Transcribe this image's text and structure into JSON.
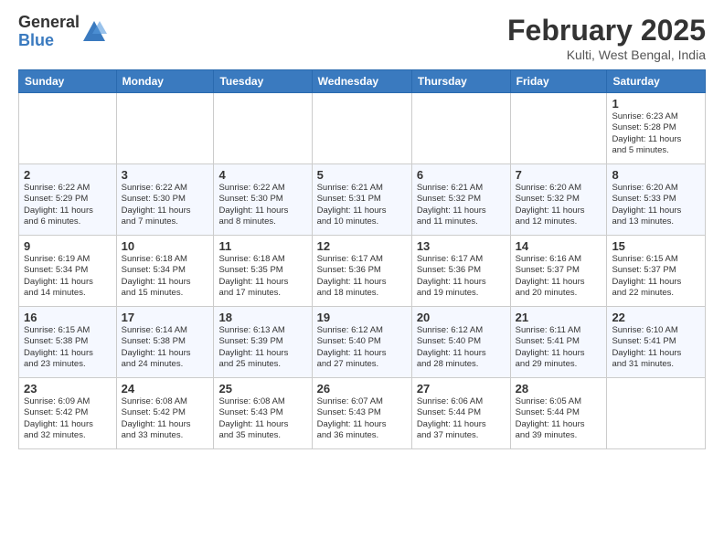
{
  "logo": {
    "general": "General",
    "blue": "Blue"
  },
  "title": "February 2025",
  "location": "Kulti, West Bengal, India",
  "days_of_week": [
    "Sunday",
    "Monday",
    "Tuesday",
    "Wednesday",
    "Thursday",
    "Friday",
    "Saturday"
  ],
  "weeks": [
    [
      {
        "day": "",
        "info": ""
      },
      {
        "day": "",
        "info": ""
      },
      {
        "day": "",
        "info": ""
      },
      {
        "day": "",
        "info": ""
      },
      {
        "day": "",
        "info": ""
      },
      {
        "day": "",
        "info": ""
      },
      {
        "day": "1",
        "info": "Sunrise: 6:23 AM\nSunset: 5:28 PM\nDaylight: 11 hours\nand 5 minutes."
      }
    ],
    [
      {
        "day": "2",
        "info": "Sunrise: 6:22 AM\nSunset: 5:29 PM\nDaylight: 11 hours\nand 6 minutes."
      },
      {
        "day": "3",
        "info": "Sunrise: 6:22 AM\nSunset: 5:30 PM\nDaylight: 11 hours\nand 7 minutes."
      },
      {
        "day": "4",
        "info": "Sunrise: 6:22 AM\nSunset: 5:30 PM\nDaylight: 11 hours\nand 8 minutes."
      },
      {
        "day": "5",
        "info": "Sunrise: 6:21 AM\nSunset: 5:31 PM\nDaylight: 11 hours\nand 10 minutes."
      },
      {
        "day": "6",
        "info": "Sunrise: 6:21 AM\nSunset: 5:32 PM\nDaylight: 11 hours\nand 11 minutes."
      },
      {
        "day": "7",
        "info": "Sunrise: 6:20 AM\nSunset: 5:32 PM\nDaylight: 11 hours\nand 12 minutes."
      },
      {
        "day": "8",
        "info": "Sunrise: 6:20 AM\nSunset: 5:33 PM\nDaylight: 11 hours\nand 13 minutes."
      }
    ],
    [
      {
        "day": "9",
        "info": "Sunrise: 6:19 AM\nSunset: 5:34 PM\nDaylight: 11 hours\nand 14 minutes."
      },
      {
        "day": "10",
        "info": "Sunrise: 6:18 AM\nSunset: 5:34 PM\nDaylight: 11 hours\nand 15 minutes."
      },
      {
        "day": "11",
        "info": "Sunrise: 6:18 AM\nSunset: 5:35 PM\nDaylight: 11 hours\nand 17 minutes."
      },
      {
        "day": "12",
        "info": "Sunrise: 6:17 AM\nSunset: 5:36 PM\nDaylight: 11 hours\nand 18 minutes."
      },
      {
        "day": "13",
        "info": "Sunrise: 6:17 AM\nSunset: 5:36 PM\nDaylight: 11 hours\nand 19 minutes."
      },
      {
        "day": "14",
        "info": "Sunrise: 6:16 AM\nSunset: 5:37 PM\nDaylight: 11 hours\nand 20 minutes."
      },
      {
        "day": "15",
        "info": "Sunrise: 6:15 AM\nSunset: 5:37 PM\nDaylight: 11 hours\nand 22 minutes."
      }
    ],
    [
      {
        "day": "16",
        "info": "Sunrise: 6:15 AM\nSunset: 5:38 PM\nDaylight: 11 hours\nand 23 minutes."
      },
      {
        "day": "17",
        "info": "Sunrise: 6:14 AM\nSunset: 5:38 PM\nDaylight: 11 hours\nand 24 minutes."
      },
      {
        "day": "18",
        "info": "Sunrise: 6:13 AM\nSunset: 5:39 PM\nDaylight: 11 hours\nand 25 minutes."
      },
      {
        "day": "19",
        "info": "Sunrise: 6:12 AM\nSunset: 5:40 PM\nDaylight: 11 hours\nand 27 minutes."
      },
      {
        "day": "20",
        "info": "Sunrise: 6:12 AM\nSunset: 5:40 PM\nDaylight: 11 hours\nand 28 minutes."
      },
      {
        "day": "21",
        "info": "Sunrise: 6:11 AM\nSunset: 5:41 PM\nDaylight: 11 hours\nand 29 minutes."
      },
      {
        "day": "22",
        "info": "Sunrise: 6:10 AM\nSunset: 5:41 PM\nDaylight: 11 hours\nand 31 minutes."
      }
    ],
    [
      {
        "day": "23",
        "info": "Sunrise: 6:09 AM\nSunset: 5:42 PM\nDaylight: 11 hours\nand 32 minutes."
      },
      {
        "day": "24",
        "info": "Sunrise: 6:08 AM\nSunset: 5:42 PM\nDaylight: 11 hours\nand 33 minutes."
      },
      {
        "day": "25",
        "info": "Sunrise: 6:08 AM\nSunset: 5:43 PM\nDaylight: 11 hours\nand 35 minutes."
      },
      {
        "day": "26",
        "info": "Sunrise: 6:07 AM\nSunset: 5:43 PM\nDaylight: 11 hours\nand 36 minutes."
      },
      {
        "day": "27",
        "info": "Sunrise: 6:06 AM\nSunset: 5:44 PM\nDaylight: 11 hours\nand 37 minutes."
      },
      {
        "day": "28",
        "info": "Sunrise: 6:05 AM\nSunset: 5:44 PM\nDaylight: 11 hours\nand 39 minutes."
      },
      {
        "day": "",
        "info": ""
      }
    ]
  ]
}
